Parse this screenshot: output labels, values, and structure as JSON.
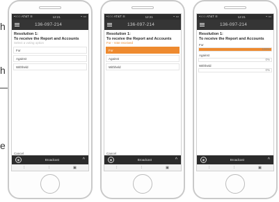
{
  "edge": {
    "letter_1": "h",
    "letter_2": "h",
    "letter_3": "e"
  },
  "status": {
    "carrier": "•○○○ AT&T ≋",
    "time": "12:21",
    "battery": "⌁ ▭"
  },
  "header": {
    "meeting_id": "136-097-214"
  },
  "phone1": {
    "title": "Resolution 1:",
    "subtitle": "To receive the Report and Accounts",
    "hint": "Select a voting option",
    "options": [
      "For",
      "Against",
      "Withheld"
    ]
  },
  "phone2": {
    "title": "Resolution 1:",
    "subtitle": "To receive the Report and Accounts",
    "hint": "For - Vote received",
    "options": [
      "For",
      "Against",
      "Withheld"
    ],
    "selected": "For"
  },
  "phone3": {
    "title": "Resolution 1:",
    "subtitle": "To receive the Report and Accounts",
    "results": [
      {
        "label": "For",
        "percent": 100,
        "display": "100%"
      },
      {
        "label": "Against",
        "percent": 0,
        "display": "0%"
      },
      {
        "label": "Withheld",
        "percent": 0,
        "display": "0%"
      }
    ]
  },
  "footer": {
    "cancel": "Cancel",
    "broadcast": "Broadcast",
    "chevron": "^"
  },
  "nav": {
    "icon1": "⫶",
    "icon2": "⫶",
    "icon3": "▣"
  },
  "colors": {
    "accent": "#ee8a2f",
    "header": "#353535",
    "bar_dark": "#2b2b2b"
  }
}
